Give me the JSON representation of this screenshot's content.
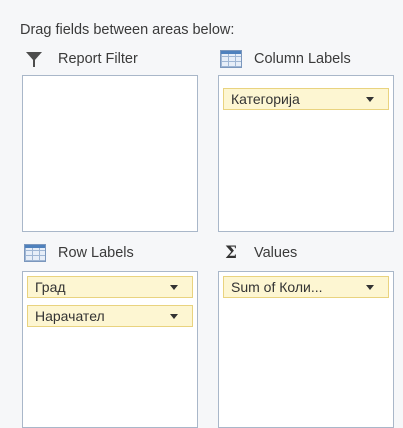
{
  "instruction": "Drag fields between areas below:",
  "areas": {
    "report_filter": {
      "label": "Report Filter",
      "icon": "filter-icon",
      "fields": []
    },
    "column_labels": {
      "label": "Column Labels",
      "icon": "column-grid-icon",
      "fields": [
        {
          "label": "Категорија"
        }
      ]
    },
    "row_labels": {
      "label": "Row Labels",
      "icon": "row-grid-icon",
      "fields": [
        {
          "label": "Град"
        },
        {
          "label": "Нарачател"
        }
      ]
    },
    "values": {
      "label": "Values",
      "icon": "sigma-icon",
      "fields": [
        {
          "label": "Sum of Коли..."
        }
      ]
    }
  },
  "colors": {
    "field_background": "#fdf6d2",
    "field_border": "#e9d37f",
    "area_border": "#a9b7c9"
  }
}
